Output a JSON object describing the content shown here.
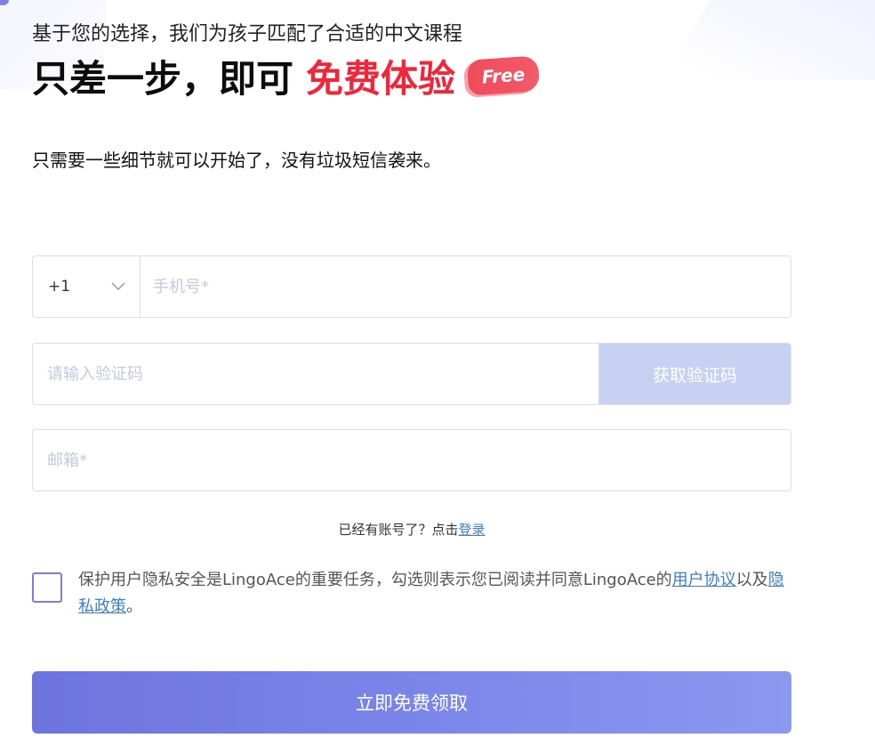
{
  "header": {
    "subtitle": "基于您的选择，我们为孩子匹配了合适的中文课程",
    "headline_main": "只差一步，即可",
    "headline_highlight": "免费体验",
    "badge": "Free"
  },
  "description": "只需要一些细节就可以开始了，没有垃圾短信袭来。",
  "form": {
    "country_code": "+1",
    "phone_placeholder": "手机号*",
    "code_placeholder": "请输入验证码",
    "get_code_label": "获取验证码",
    "email_placeholder": "邮箱*"
  },
  "login": {
    "prompt": "已经有账号了？点击",
    "link": "登录"
  },
  "agreement": {
    "text_part1": "保护用户隐私安全是LingoAce的重要任务，勾选则表示您已阅读并同意LingoAce的",
    "user_agreement": "用户协议",
    "text_part2": "以及",
    "privacy_policy": "隐私政策",
    "text_end": "。"
  },
  "submit_label": "立即免费领取",
  "colors": {
    "highlight_red": "#f0263a",
    "button_gradient_start": "#6d74de",
    "button_gradient_end": "#8b98f0",
    "code_button_bg": "#c7d2f2",
    "link_blue": "#3b80c7",
    "checkbox_border": "#7a7fd8"
  }
}
